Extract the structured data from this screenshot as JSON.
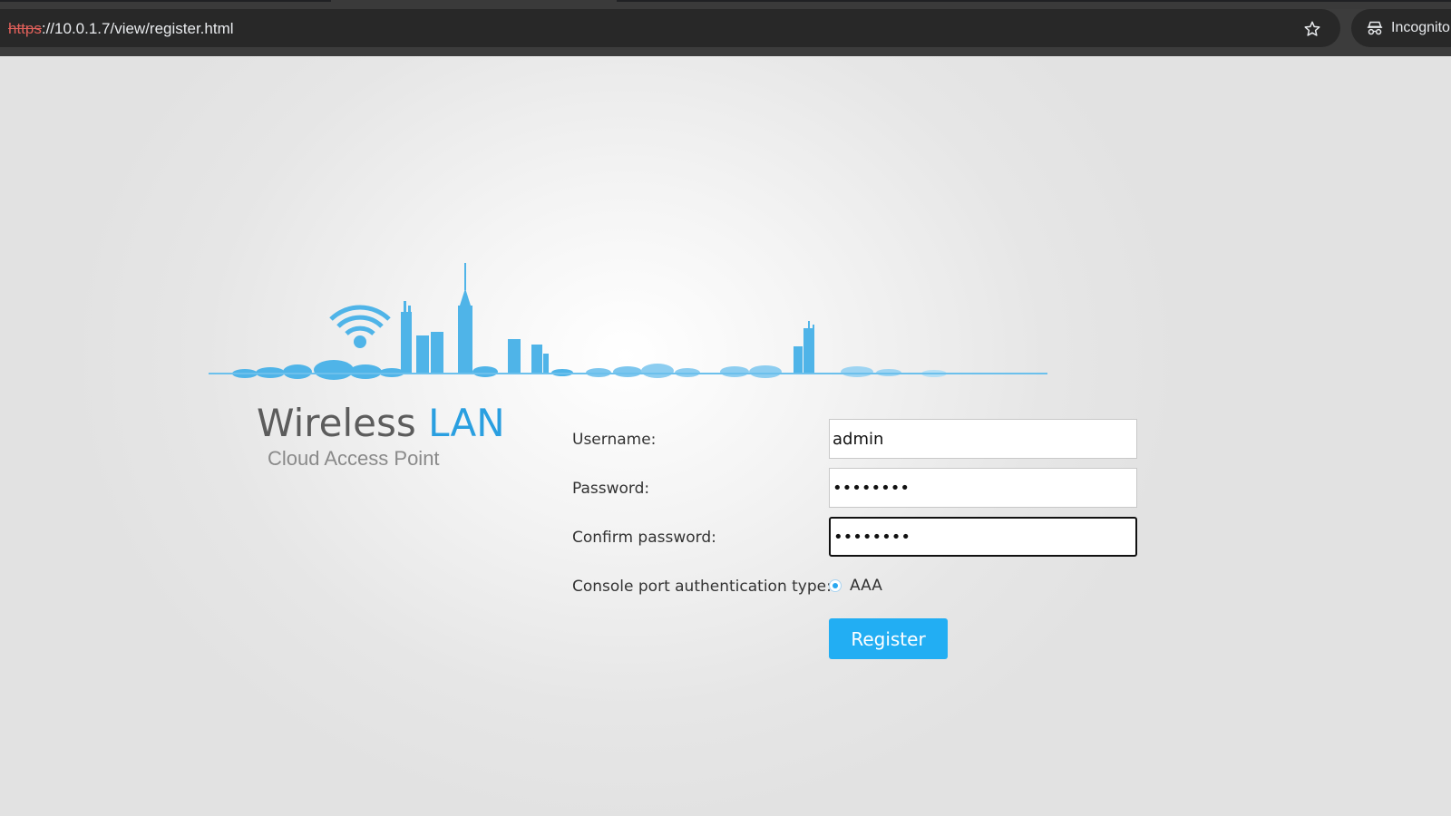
{
  "browser": {
    "url_scheme": "https",
    "url_rest": "://10.0.1.7/view/register.html",
    "profile_label": "Incognito",
    "bookmark_icon": "star-icon",
    "profile_icon": "incognito-icon"
  },
  "brand": {
    "title_part1": "Wireless ",
    "title_part2": "LAN",
    "subtitle": "Cloud Access Point",
    "accent_color": "#2a9fe0"
  },
  "form": {
    "username_label": "Username:",
    "username_value": "admin",
    "password_label": "Password:",
    "password_value": "••••••••",
    "confirm_label": "Confirm password:",
    "confirm_value": "••••••••",
    "console_label": "Console port authentication type:",
    "console_option": "AAA",
    "register_label": "Register",
    "button_color": "#22aef3"
  }
}
